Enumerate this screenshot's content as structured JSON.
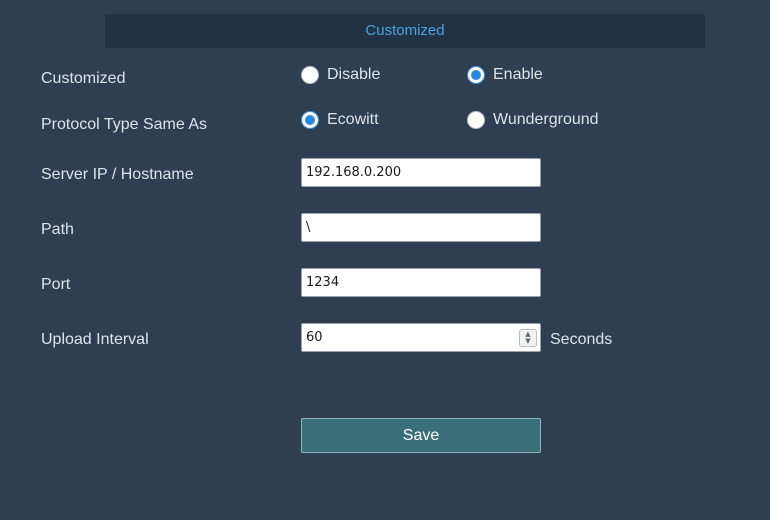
{
  "section": {
    "title": "Customized"
  },
  "rows": {
    "customized": {
      "label": "Customized",
      "options": [
        "Disable",
        "Enable"
      ],
      "selected": "Enable"
    },
    "protocol": {
      "label": "Protocol Type Same As",
      "options": [
        "Ecowitt",
        "Wunderground"
      ],
      "selected": "Ecowitt"
    },
    "server": {
      "label": "Server IP / Hostname",
      "value": "192.168.0.200"
    },
    "path": {
      "label": "Path",
      "value": "\\"
    },
    "port": {
      "label": "Port",
      "value": "1234"
    },
    "interval": {
      "label": "Upload Interval",
      "value": "60",
      "unit": "Seconds"
    }
  },
  "actions": {
    "save_label": "Save"
  },
  "colors": {
    "background": "#2f3e50",
    "header_bg": "#213244",
    "header_text": "#4aa3df",
    "radio_accent": "#2b88e0",
    "button_bg": "#3b707a"
  }
}
